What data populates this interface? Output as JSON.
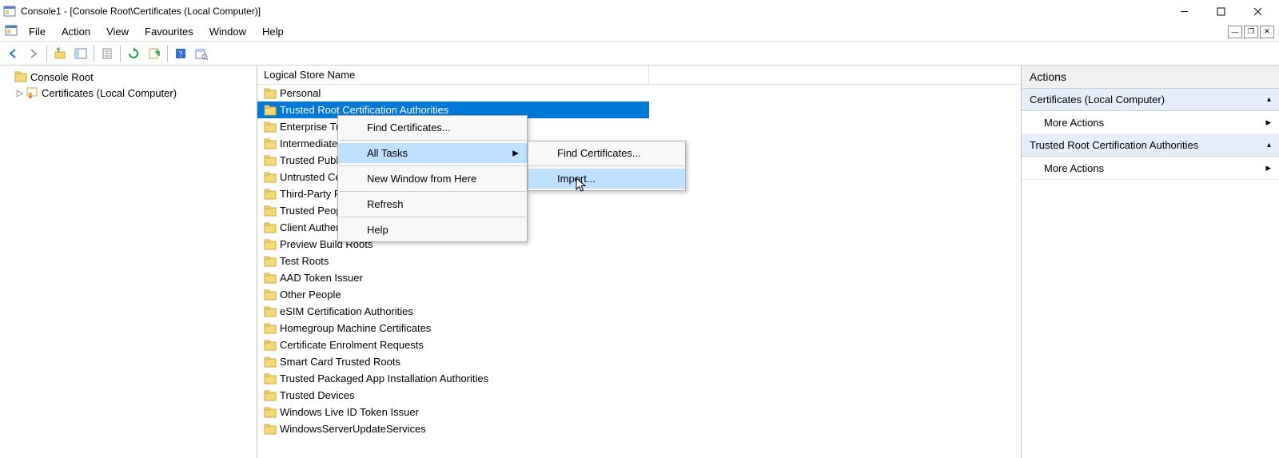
{
  "window": {
    "title": "Console1 - [Console Root\\Certificates (Local Computer)]"
  },
  "menu": {
    "file": "File",
    "action": "Action",
    "view": "View",
    "favourites": "Favourites",
    "window": "Window",
    "help": "Help"
  },
  "tree": {
    "root": "Console Root",
    "child": "Certificates (Local Computer)"
  },
  "list": {
    "header": "Logical Store Name",
    "items": [
      "Personal",
      "Trusted Root Certification Authorities",
      "Enterprise Trust",
      "Intermediate Certification Authorities",
      "Trusted Publishers",
      "Untrusted Certificates",
      "Third-Party Root Certification Authorities",
      "Trusted People",
      "Client Authentication Issuers",
      "Preview Build Roots",
      "Test Roots",
      "AAD Token Issuer",
      "Other People",
      "eSIM Certification Authorities",
      "Homegroup Machine Certificates",
      "Certificate Enrolment Requests",
      "Smart Card Trusted Roots",
      "Trusted Packaged App Installation Authorities",
      "Trusted Devices",
      "Windows Live ID Token Issuer",
      "WindowsServerUpdateServices"
    ],
    "selected_index": 1
  },
  "actions": {
    "header": "Actions",
    "group1": "Certificates (Local Computer)",
    "more1": "More Actions",
    "group2": "Trusted Root Certification Authorities",
    "more2": "More Actions"
  },
  "context_menu": {
    "find": "Find Certificates...",
    "all_tasks": "All Tasks",
    "new_window": "New Window from Here",
    "refresh": "Refresh",
    "help": "Help"
  },
  "submenu": {
    "find": "Find Certificates...",
    "import": "Import..."
  }
}
